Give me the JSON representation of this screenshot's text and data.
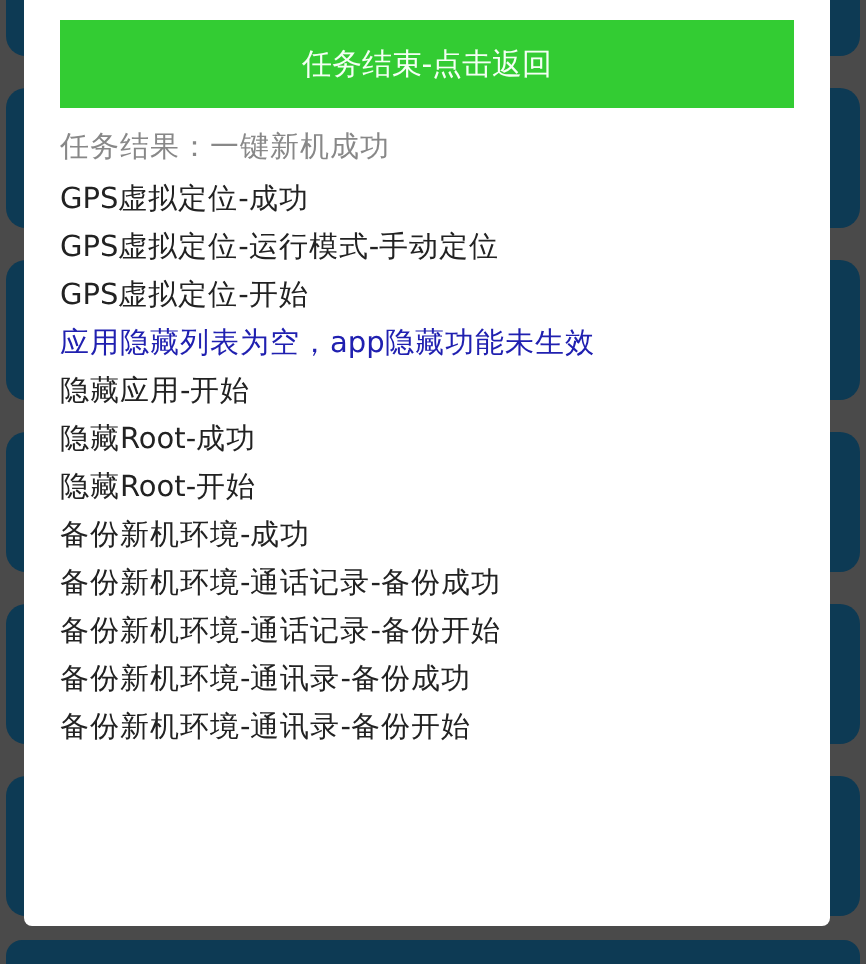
{
  "dialog": {
    "button": "任务结束-点击返回",
    "lines": [
      {
        "kind": "summary",
        "text": "任务结果：一键新机成功"
      },
      {
        "kind": "log",
        "text": "GPS虚拟定位-成功"
      },
      {
        "kind": "log",
        "text": "GPS虚拟定位-运行模式-手动定位"
      },
      {
        "kind": "log",
        "text": "GPS虚拟定位-开始"
      },
      {
        "kind": "warning",
        "text": "应用隐藏列表为空，app隐藏功能未生效"
      },
      {
        "kind": "log",
        "text": "隐藏应用-开始"
      },
      {
        "kind": "log",
        "text": "隐藏Root-成功"
      },
      {
        "kind": "log",
        "text": "隐藏Root-开始"
      },
      {
        "kind": "log",
        "text": "备份新机环境-成功"
      },
      {
        "kind": "log",
        "text": "备份新机环境-通话记录-备份成功"
      },
      {
        "kind": "log",
        "text": "备份新机环境-通话记录-备份开始"
      },
      {
        "kind": "log",
        "text": "备份新机环境-通讯录-备份成功"
      },
      {
        "kind": "log",
        "text": "备份新机环境-通讯录-备份开始"
      }
    ]
  }
}
